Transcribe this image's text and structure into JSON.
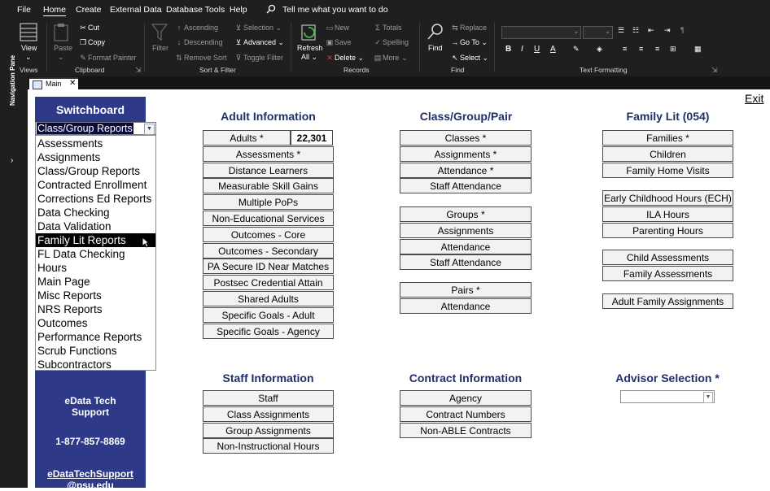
{
  "menu": {
    "file": "File",
    "home": "Home",
    "create": "Create",
    "external_data": "External Data",
    "database_tools": "Database Tools",
    "help": "Help",
    "tell_me": "Tell me what you want to do"
  },
  "ribbon": {
    "views": {
      "view": "View",
      "label": "Views"
    },
    "clipboard": {
      "paste": "Paste",
      "cut": "Cut",
      "copy": "Copy",
      "format_painter": "Format Painter",
      "label": "Clipboard"
    },
    "sort_filter": {
      "filter": "Filter",
      "ascending": "Ascending",
      "descending": "Descending",
      "remove_sort": "Remove Sort",
      "selection": "Selection",
      "advanced": "Advanced",
      "toggle_filter": "Toggle Filter",
      "label": "Sort & Filter"
    },
    "records": {
      "refresh": "Refresh",
      "refresh_all": "All",
      "new": "New",
      "save": "Save",
      "delete": "Delete",
      "totals": "Totals",
      "spelling": "Spelling",
      "more": "More",
      "label": "Records"
    },
    "find": {
      "find": "Find",
      "replace": "Replace",
      "go_to": "Go To",
      "select": "Select",
      "label": "Find"
    },
    "text_formatting": {
      "label": "Text Formatting",
      "bold": "B",
      "italic": "I",
      "underline": "U",
      "font_color": "A"
    }
  },
  "nav_pane": {
    "label": "Navigation Pane"
  },
  "doc_tab": {
    "label": "Main"
  },
  "switchboard": {
    "title": "Switchboard",
    "combo_value": "Class/Group Reports",
    "items": [
      "Assessments",
      "Assignments",
      "Class/Group Reports",
      "Contracted Enrollment",
      "Corrections Ed Reports",
      "Data Checking",
      "Data Validation",
      "Family Lit Reports",
      "FL Data Checking",
      "Hours",
      "Main Page",
      "Misc Reports",
      "NRS Reports",
      "Outcomes",
      "Performance Reports",
      "Scrub Functions",
      "Subcontractors"
    ],
    "selected_index": 7
  },
  "support": {
    "title_line1": "eData Tech",
    "title_line2": "Support",
    "phone": "1-877-857-8869",
    "email_line1": "eDataTechSupport",
    "email_line2": "@psu.edu"
  },
  "exit": "Exit",
  "adult": {
    "heading": "Adult Information",
    "count": "22,301",
    "buttons": [
      "Adults *",
      "Assessments *",
      "Distance Learners",
      "Measurable Skill Gains",
      "Multiple PoPs",
      "Non-Educational Services",
      "Outcomes - Core",
      "Outcomes - Secondary",
      "PA Secure ID Near Matches",
      "Postsec Credential Attain",
      "Shared Adults",
      "Specific Goals - Adult",
      "Specific Goals - Agency"
    ]
  },
  "classgroup": {
    "heading": "Class/Group/Pair",
    "classes": [
      "Classes *",
      "Assignments *",
      "Attendance *",
      "Staff Attendance"
    ],
    "groups": [
      "Groups *",
      "Assignments",
      "Attendance",
      "Staff Attendance"
    ],
    "pairs": [
      "Pairs *",
      "Attendance"
    ]
  },
  "familylit": {
    "heading": "Family Lit (054)",
    "group1": [
      "Families *",
      "Children",
      "Family Home Visits"
    ],
    "group2": [
      "Early Childhood Hours (ECH)",
      "ILA Hours",
      "Parenting Hours"
    ],
    "group3": [
      "Child Assessments",
      "Family Assessments"
    ],
    "group4": [
      "Adult Family Assignments"
    ]
  },
  "staff": {
    "heading": "Staff  Information",
    "buttons": [
      "Staff",
      "Class Assignments",
      "Group Assignments",
      "Non-Instructional Hours"
    ]
  },
  "contract": {
    "heading": "Contract  Information",
    "buttons": [
      "Agency",
      "Contract Numbers",
      "Non-ABLE Contracts"
    ]
  },
  "advisor": {
    "heading": "Advisor Selection *",
    "value": ""
  }
}
